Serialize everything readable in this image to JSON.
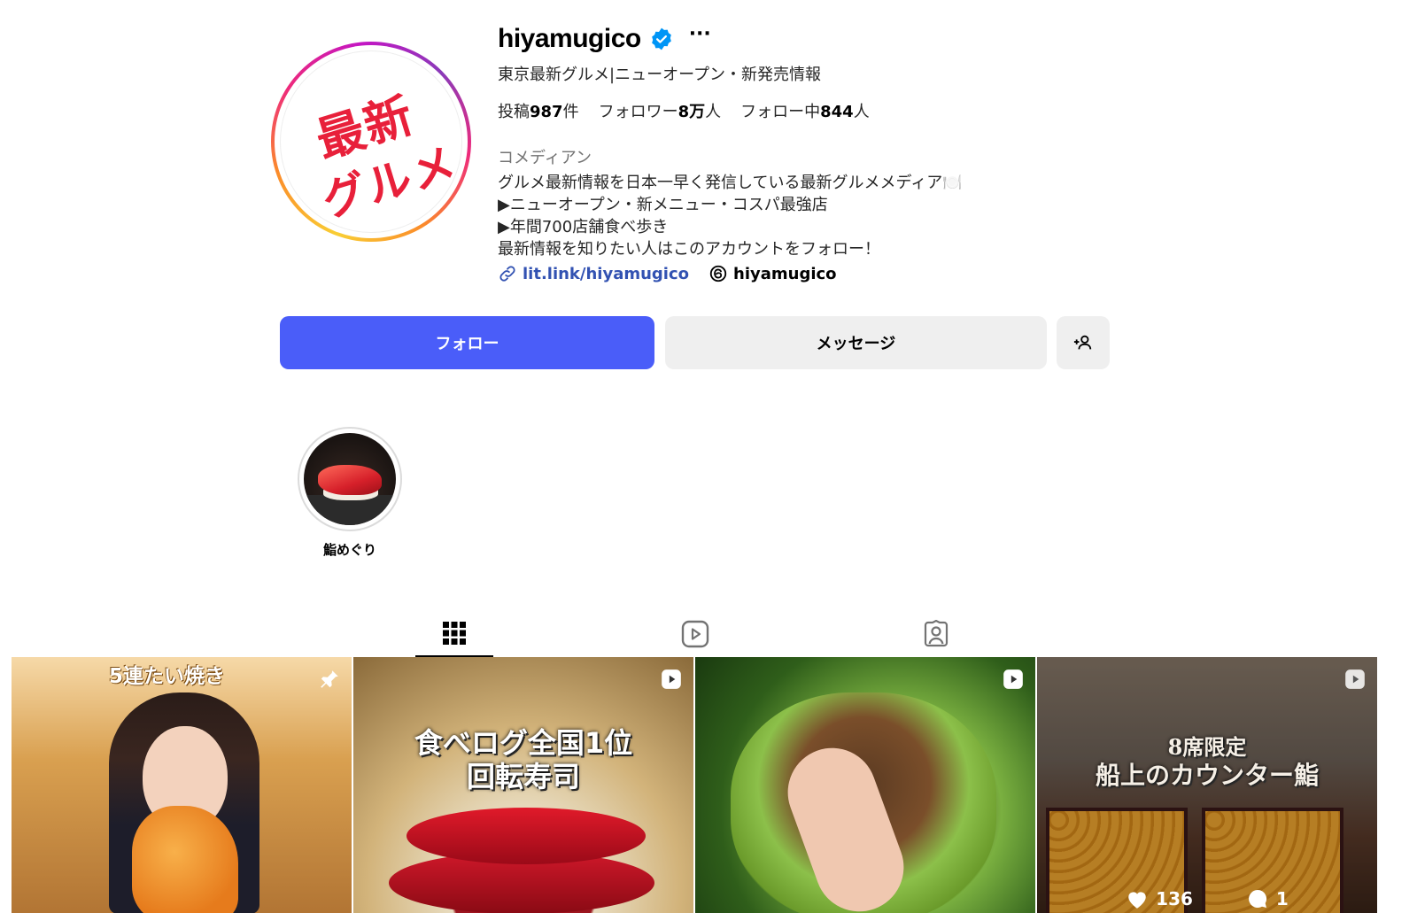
{
  "profile": {
    "username": "hiyamugico",
    "subtitle": "東京最新グルメ|ニューオープン・新発売情報",
    "stats": {
      "posts_label": "投稿",
      "posts_value": "987",
      "posts_unit": "件",
      "followers_label": "フォロワー",
      "followers_value": "8万",
      "followers_unit": "人",
      "following_label": "フォロー中",
      "following_value": "844",
      "following_unit": "人"
    },
    "category": "コメディアン",
    "bio": [
      "グルメ最新情報を日本一早く発信している最新グルメメディア🍽️",
      "▶ニューオープン・新メニュー・コスパ最強店",
      "▶年間700店舗食べ歩き",
      "最新情報を知りたい人はこのアカウントをフォロー！"
    ],
    "link": "lit.link/hiyamugico",
    "threads": "hiyamugico",
    "avatar_text": [
      "最新",
      "グルメ"
    ]
  },
  "buttons": {
    "follow": "フォロー",
    "message": "メッセージ",
    "suggest": "+👤"
  },
  "highlights": [
    {
      "label": "鮨めぐり"
    }
  ],
  "tabs": [
    "posts-grid-icon",
    "reels-icon",
    "tagged-icon"
  ],
  "posts": [
    {
      "caption": "5連たい焼き",
      "badge": "pin-icon"
    },
    {
      "caption_lines": [
        "食べログ全国1位",
        "回転寿司"
      ],
      "badge": "reel-icon"
    },
    {
      "badge": "reel-icon"
    },
    {
      "caption_lines": [
        "8席限定",
        "船上のカウンター鮨"
      ],
      "badge": "reel-icon",
      "likes": "136",
      "comments": "1"
    }
  ],
  "colors": {
    "follow_button": "#4a5df9",
    "secondary_button": "#efefef",
    "link": "#3252b2",
    "verified": "#0095f6"
  }
}
